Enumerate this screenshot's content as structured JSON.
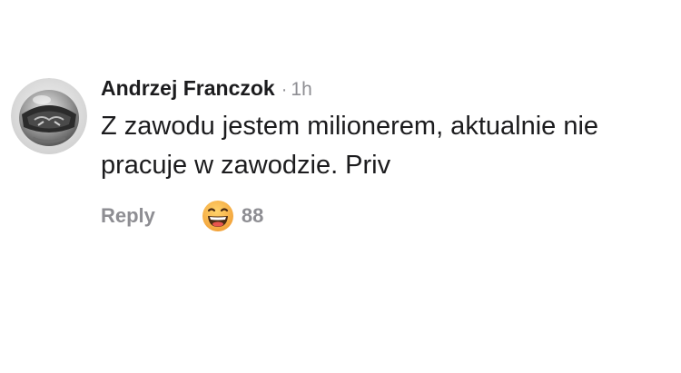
{
  "comment": {
    "author": "Andrzej Franczok",
    "separator": "·",
    "time": "1h",
    "text": "Z zawodu jestem milionerem, aktualnie nie pracuje w zawodzie. Priv",
    "reply_label": "Reply",
    "reaction": {
      "icon": "laughing-emoji-icon",
      "count": "88"
    },
    "avatar_icon": "helmet-avatar-icon"
  },
  "colors": {
    "text": "#1c1c1e",
    "muted": "#8e8e93",
    "emoji_face": "#f7b84a"
  }
}
